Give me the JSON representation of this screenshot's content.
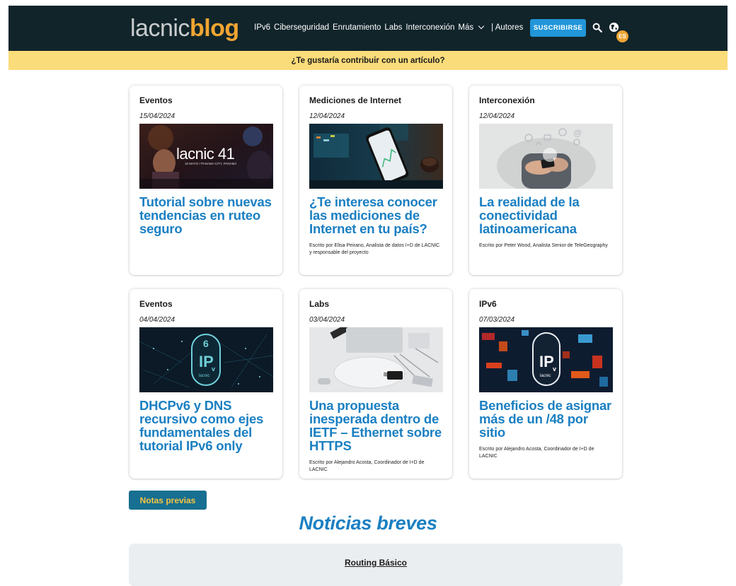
{
  "header": {
    "logo_part1": "lacnic",
    "logo_part2": "blog",
    "nav": [
      {
        "label": "IPv6"
      },
      {
        "label": "Ciberseguridad"
      },
      {
        "label": "Enrutamiento"
      },
      {
        "label": "Labs"
      },
      {
        "label": "Interconexión"
      },
      {
        "label": "Más"
      },
      {
        "label": "| Autores"
      }
    ],
    "subscribe_label": "SUSCRIBIRSE",
    "lang_badge": "ES",
    "search_icon": "search-icon",
    "globe_icon": "globe-icon"
  },
  "banner": {
    "text": "¿Te gustaría contribuir con un artículo?"
  },
  "cards": [
    {
      "category": "Eventos",
      "date": "15/04/2024",
      "image_text": "lacnic 41",
      "image_sub": "10 MAYO / PANAMA CITY, PANAMÁ",
      "title": "Tutorial sobre nuevas tendencias en ruteo seguro",
      "author": ""
    },
    {
      "category": "Mediciones de Internet",
      "date": "12/04/2024",
      "image_text": "",
      "image_sub": "",
      "title": "¿Te interesa conocer las mediciones de Internet en tu país?",
      "author": "Escrito por Elisa Peirano, Analista de datos I+D de LACNIC y responsable del proyecto"
    },
    {
      "category": "Interconexión",
      "date": "12/04/2024",
      "image_text": "",
      "image_sub": "",
      "title": "La realidad de la conectividad latinoamericana",
      "author": "Escrito por Peter Wood, Analista Senior de TeleGeography"
    },
    {
      "category": "Eventos",
      "date": "04/04/2024",
      "image_text": "IPv",
      "image_sub": "lacnic",
      "title": "DHCPv6 y DNS recursivo como ejes fundamentales del tutorial IPv6 only",
      "author": ""
    },
    {
      "category": "Labs",
      "date": "03/04/2024",
      "image_text": "",
      "image_sub": "",
      "title": "Una propuesta inesperada dentro de IETF – Ethernet sobre HTTPS",
      "author": "Escrito por Alejandro Acosta, Coordinador de I+D de LACNIC"
    },
    {
      "category": "IPv6",
      "date": "07/03/2024",
      "image_text": "IPv",
      "image_sub": "lacnic",
      "title": "Beneficios de asignar más de un /48 por sitio",
      "author": "Escrito por Alejandro Acosta, Coordinador de I+D de LACNIC"
    }
  ],
  "previous_notes_label": "Notas previas",
  "brief_news": {
    "heading": "Noticias breves",
    "first_item": "Routing Básico"
  },
  "colors": {
    "header_bg": "#11242a",
    "accent_orange": "#f1a532",
    "banner_yellow": "#fbdc7a",
    "title_blue": "#1a7fc2",
    "subscribe_blue": "#2196d9",
    "button_teal": "#176f91"
  }
}
